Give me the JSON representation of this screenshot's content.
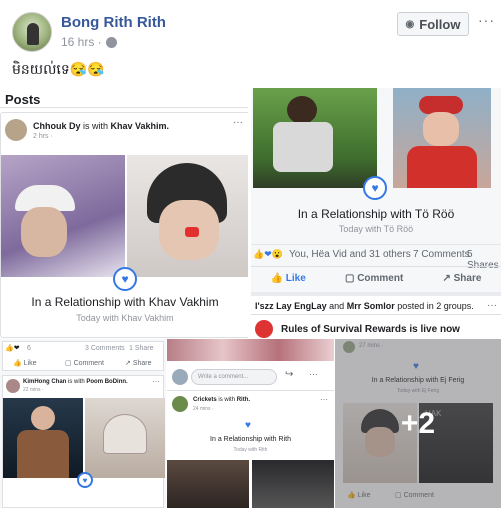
{
  "post": {
    "author": "Bong Rith Rith",
    "time": "16 hrs ·",
    "follow_label": "Follow",
    "more": "···",
    "caption": "មិនយល់ទេ😪😪"
  },
  "tile1": {
    "section": "Posts",
    "poster": "Chhouk Dy",
    "poster_suffix": " is with ",
    "tagged": "Khav Vakhim.",
    "time": "2 hrs · ",
    "title": "In a Relationship with Khav Vakhim",
    "sub": "Today with Khav Vakhim"
  },
  "tile2": {
    "title": "In a Relationship with Tö Röö",
    "sub": "Today with Tö Röö",
    "reactions": "You, Hëa Vid and 31 others",
    "comments": "7 Comments",
    "shares": "5 Shares",
    "like": "Like",
    "comment": "Comment",
    "share": "Share",
    "group_line_a": "I'szz Lay EngLay",
    "group_line_b": " and ",
    "group_line_c": "Mrr Somlor",
    "group_line_d": " posted in 2 groups.",
    "next_title": "Rules of Survival Rewards is live now"
  },
  "tile3": {
    "count": "6",
    "comments": "3 Comments",
    "shares": "1 Share",
    "like": "Like",
    "comment": "Comment",
    "share": "Share",
    "poster": "KimHong Chan",
    "poster_suffix": " is with ",
    "tagged": "Poom BoDinn.",
    "time": "22 mins · "
  },
  "tile4": {
    "comment_placeholder": "Write a comment...",
    "poster": "Crickets",
    "poster_suffix": " is with ",
    "tagged": "Rith.",
    "time": "24 mins · ",
    "title": "In a Relationship with Rith",
    "sub": "Today with Rith"
  },
  "tile5": {
    "time": "27 mins · ",
    "title": "In a Relationship with Ej Ferig",
    "sub": "Today with Ej Ferig",
    "more_count": "+2",
    "like": "Like",
    "comment": "Comment"
  },
  "colors": {
    "link": "#365899",
    "accent": "#3578e5",
    "muted": "#90949c"
  }
}
